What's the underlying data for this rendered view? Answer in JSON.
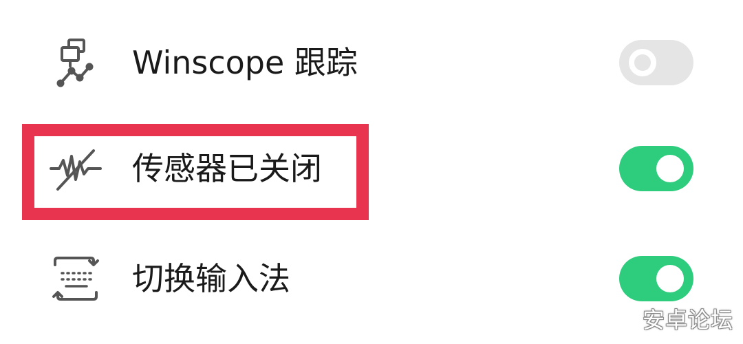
{
  "settings": {
    "items": [
      {
        "id": "winscope",
        "label": "Winscope 跟踪",
        "icon": "winscope-trace-icon",
        "enabled": false
      },
      {
        "id": "sensors-off",
        "label": "传感器已关闭",
        "icon": "sensors-off-icon",
        "enabled": true
      },
      {
        "id": "switch-ime",
        "label": "切换输入法",
        "icon": "keyboard-switch-icon",
        "enabled": true
      }
    ]
  },
  "highlighted_item": "sensors-off",
  "watermark": "安卓论坛",
  "colors": {
    "toggle_on": "#2ecd7e",
    "toggle_off": "#e5e5e5",
    "highlight_border": "#e8344f",
    "label_text": "#1a1a1a",
    "icon_stroke": "#555555"
  }
}
